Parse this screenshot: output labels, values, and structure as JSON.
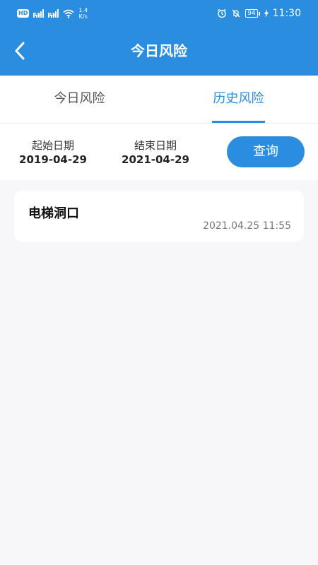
{
  "status_bar": {
    "network_left": "4G",
    "network_right": "4G",
    "speed_value": "1.4",
    "speed_unit": "K/s",
    "battery": "94",
    "time": "11:30",
    "icons": [
      "hd-icon",
      "signal-icon",
      "wifi-icon",
      "alarm-icon",
      "mute-icon",
      "battery-icon",
      "charging-icon"
    ]
  },
  "app_bar": {
    "title": "今日风险",
    "back_icon": "back-arrow-icon"
  },
  "tabs": [
    {
      "label": "今日风险",
      "active": false
    },
    {
      "label": "历史风险",
      "active": true
    }
  ],
  "filter": {
    "start_label": "起始日期",
    "start_value": "2019-04-29",
    "end_label": "结束日期",
    "end_value": "2021-04-29",
    "query_label": "查询"
  },
  "list": {
    "items": [
      {
        "title": "电梯洞口",
        "time": "2021.04.25 11:55"
      }
    ]
  },
  "colors": {
    "primary": "#2b8de0",
    "background": "#f7f7f9"
  }
}
